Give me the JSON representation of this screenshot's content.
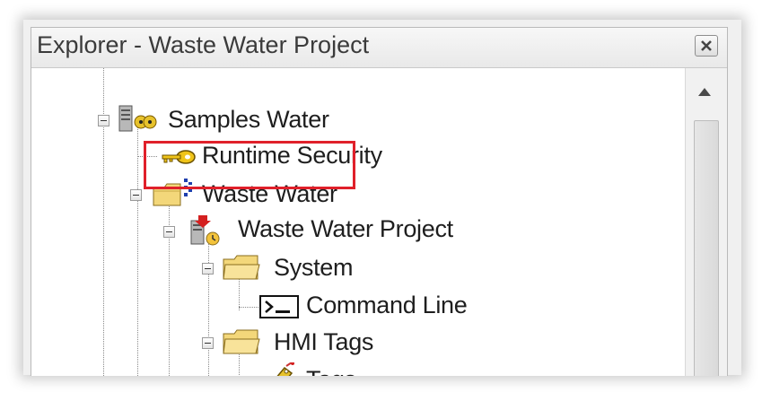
{
  "window": {
    "title": "Explorer - Waste Water Project",
    "close_icon": "close-icon"
  },
  "tree": {
    "nodes": [
      {
        "label": "Samples Water",
        "icon": "server-icon",
        "expanded": true
      },
      {
        "label": "Runtime Security",
        "icon": "key-icon"
      },
      {
        "label": "Waste Water",
        "icon": "application-folder-icon",
        "expanded": true,
        "highlighted": true
      },
      {
        "label": "Waste Water Project",
        "icon": "project-icon",
        "expanded": true
      },
      {
        "label": "System",
        "icon": "folder-icon",
        "expanded": true
      },
      {
        "label": "Command Line",
        "icon": "command-line-icon"
      },
      {
        "label": "HMI Tags",
        "icon": "folder-icon",
        "expanded": true
      },
      {
        "label": "Tags",
        "icon": "tags-icon"
      }
    ]
  },
  "colors": {
    "highlight": "#e0202a",
    "folder": "#f3d77a"
  }
}
